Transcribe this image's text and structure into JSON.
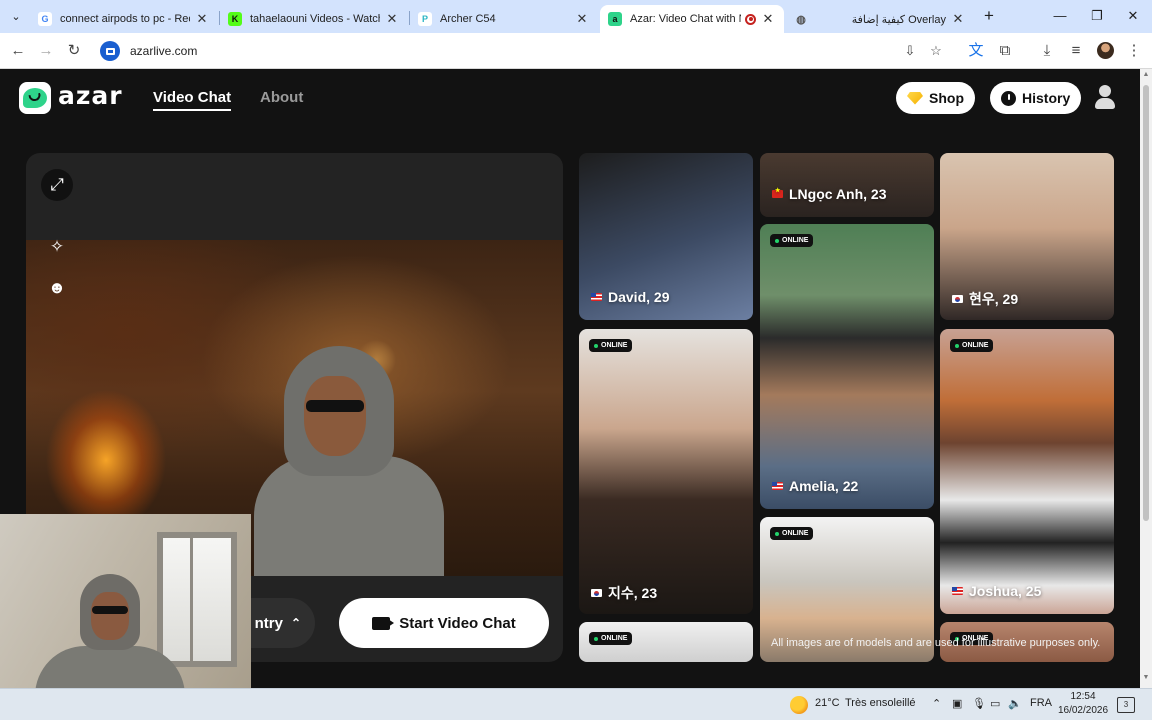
{
  "browser": {
    "tabs": [
      {
        "title": "connect airpods to pc - Recher",
        "favicon": "google-icon",
        "color": "#4285f4"
      },
      {
        "title": "tahaelaouni Videos - Watch On",
        "favicon": "kick-icon",
        "color": "#53fc18"
      },
      {
        "title": "Archer C54",
        "favicon": "tp-link-icon",
        "color": "#2bb6c4"
      },
      {
        "title": "Azar: Video Chat with New",
        "favicon": "azar-icon",
        "color": "#2ed38a"
      },
      {
        "title": "كيفية إضافة Overlay",
        "favicon": "globe-icon",
        "color": "#777777"
      }
    ],
    "url": "azarlive.com"
  },
  "site": {
    "brand": "azar",
    "nav": {
      "video_chat": "Video Chat",
      "about": "About"
    },
    "shop_label": "Shop",
    "history_label": "History",
    "country_label": "ntry",
    "start_label": "Start Video Chat",
    "online_badge": "ONLINE",
    "disclaimer": "All images are of models and are used for illustrative purposes only.",
    "accent": "#2ed38a"
  },
  "profiles": [
    {
      "name": "David, 29",
      "flag": "us"
    },
    {
      "name": "LNgọc Anh, 23",
      "flag": "vn"
    },
    {
      "name": "현우, 29",
      "flag": "kr"
    },
    {
      "name": "지수, 23",
      "flag": "kr"
    },
    {
      "name": "Amelia, 22",
      "flag": "us"
    },
    {
      "name": "Joshua, 25",
      "flag": "us"
    }
  ],
  "taskbar": {
    "temperature": "21°C",
    "weather": "Très ensoleillé",
    "language": "FRA",
    "time": "12:54",
    "date": "16/02/2026",
    "notifications": "3"
  }
}
